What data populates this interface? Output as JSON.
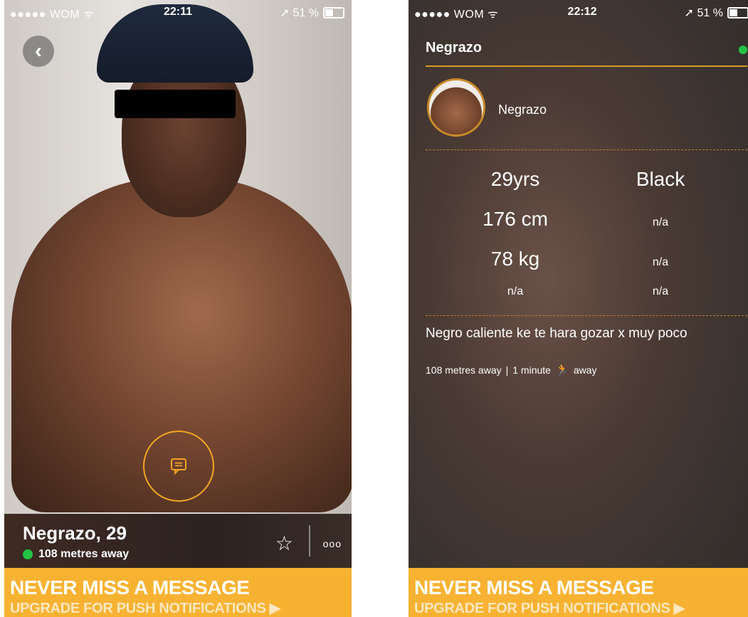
{
  "left": {
    "status": {
      "carrier": "●●●●● WOM ᯤ",
      "time": "22:11",
      "battery": "➚ 51 %"
    },
    "profile": {
      "name_age": "Negrazo, 29",
      "distance": "108 metres away"
    },
    "actions": {
      "more": "ooo"
    },
    "banner": {
      "line1": "NEVER MISS A MESSAGE",
      "line2": "UPGRADE FOR PUSH NOTIFICATIONS ▶"
    }
  },
  "right": {
    "status": {
      "carrier": "●●●●● WOM ᯤ",
      "time": "22:12",
      "battery": "➚ 51 %"
    },
    "title": "Negrazo",
    "avatar_name": "Negrazo",
    "stats": {
      "age": "29yrs",
      "ethnicity": "Black",
      "height": "176 cm",
      "h_right": "n/a",
      "weight": "78 kg",
      "w_right": "n/a",
      "row4_left": "n/a",
      "row4_right": "n/a"
    },
    "description": "Negro caliente ke te hara gozar x muy poco",
    "meta": {
      "distance": "108 metres away",
      "separator": "|",
      "time": "1 minute",
      "away": "away"
    },
    "banner": {
      "line1": "NEVER MISS A MESSAGE",
      "line2": "UPGRADE FOR PUSH NOTIFICATIONS ▶"
    }
  },
  "colors": {
    "accent": "#f8b232",
    "online": "#23c244",
    "gold_line": "#d89a22"
  }
}
